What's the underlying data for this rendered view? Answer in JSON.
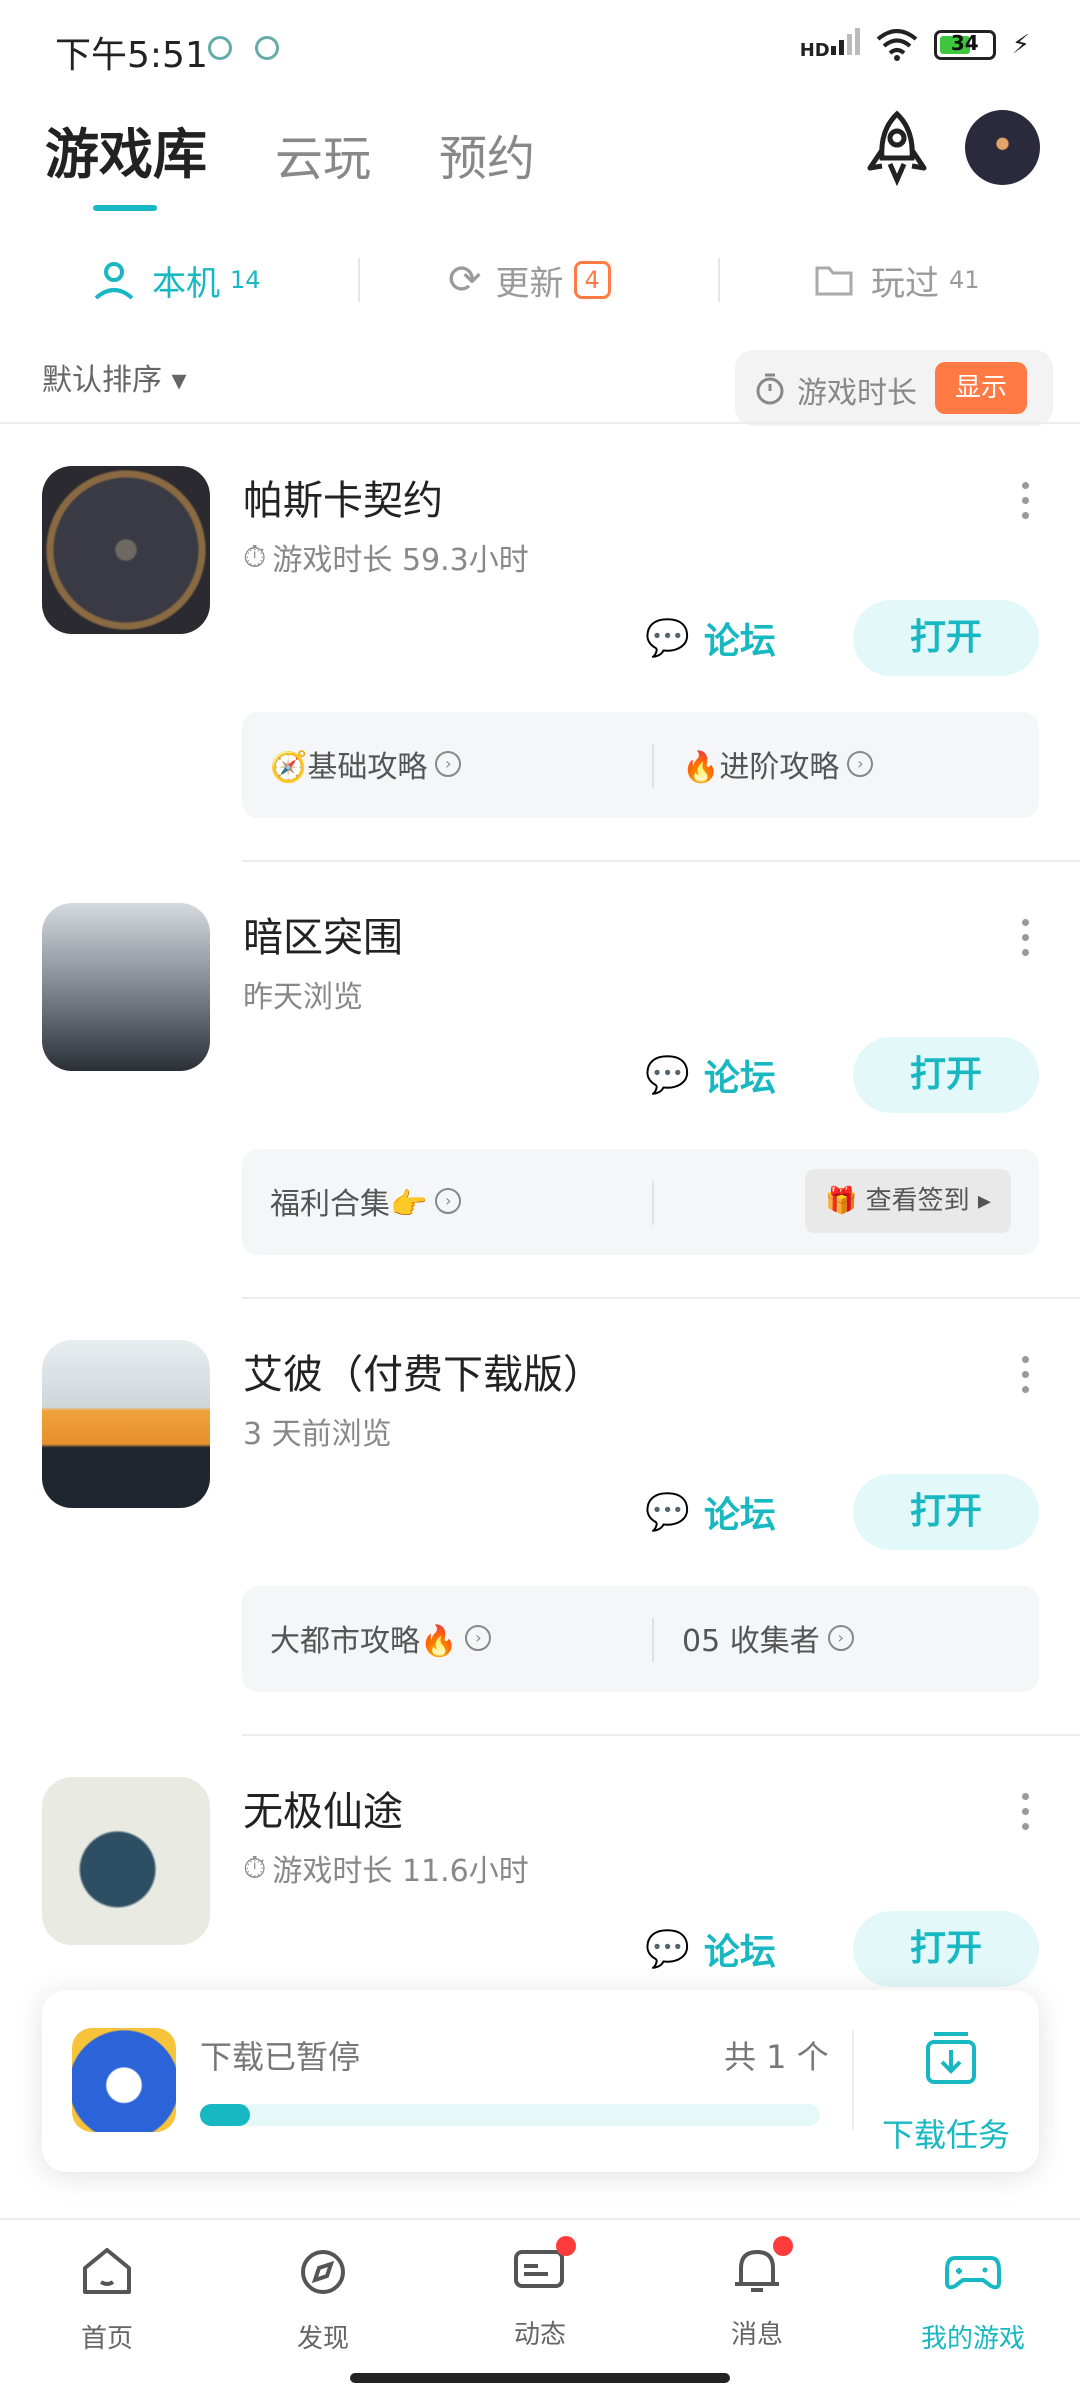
{
  "status_bar": {
    "time": "下午5:51",
    "battery": "34",
    "signal_label": "HD"
  },
  "header": {
    "tabs": [
      "游戏库",
      "云玩",
      "预约"
    ],
    "active_tab": 0
  },
  "sub_tabs": [
    {
      "label": "本机",
      "count": "14"
    },
    {
      "label": "更新",
      "count": "4"
    },
    {
      "label": "玩过",
      "count": "41"
    }
  ],
  "sort": {
    "label": "默认排序 ▾"
  },
  "play_time_toggle": {
    "label": "游戏时长",
    "button": "显示"
  },
  "actions": {
    "forum": "论坛",
    "open": "打开"
  },
  "games": [
    {
      "name": "帕斯卡契约",
      "sub": "游戏时长 59.3小时",
      "has_timer": true,
      "guides": [
        "🧭基础攻略",
        "🔥进阶攻略"
      ]
    },
    {
      "name": "暗区突围",
      "sub": "昨天浏览",
      "has_timer": false,
      "guides": [
        "福利合集👉"
      ],
      "checkin": "查看签到 ▸"
    },
    {
      "name": "艾彼（付费下载版）",
      "sub": "3 天前浏览",
      "has_timer": false,
      "guides": [
        "大都市攻略🔥",
        "05 收集者"
      ]
    },
    {
      "name": "无极仙途",
      "sub": "游戏时长 11.6小时",
      "has_timer": true,
      "guides": []
    }
  ],
  "download": {
    "status": "下载已暂停",
    "count": "共 1 个",
    "progress": 0.08,
    "task_label": "下载任务"
  },
  "bottom_nav": [
    {
      "label": "首页",
      "icon": "home-icon"
    },
    {
      "label": "发现",
      "icon": "compass-icon"
    },
    {
      "label": "动态",
      "icon": "chat-icon",
      "dot": true
    },
    {
      "label": "消息",
      "icon": "bell-icon",
      "dot": true
    },
    {
      "label": "我的游戏",
      "icon": "gamepad-icon",
      "active": true
    }
  ],
  "colors": {
    "accent": "#18b8c2",
    "orange": "#ff7a45"
  }
}
